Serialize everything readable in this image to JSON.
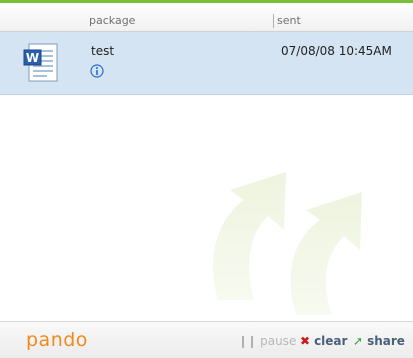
{
  "header": {
    "col_package": "package",
    "col_sent": "sent"
  },
  "rows": [
    {
      "file_icon": "word-document-icon",
      "name": "test",
      "sent": "07/08/08 10:45AM",
      "info_icon": "info-icon"
    }
  ],
  "footer": {
    "logo": "pando",
    "pause_label": "pause",
    "clear_label": "clear",
    "share_label": "share"
  },
  "colors": {
    "accent_green": "#7bbf38",
    "logo_orange": "#f08a1c",
    "row_selected": "#d5e4f2",
    "clear_red": "#cc1a1a"
  }
}
